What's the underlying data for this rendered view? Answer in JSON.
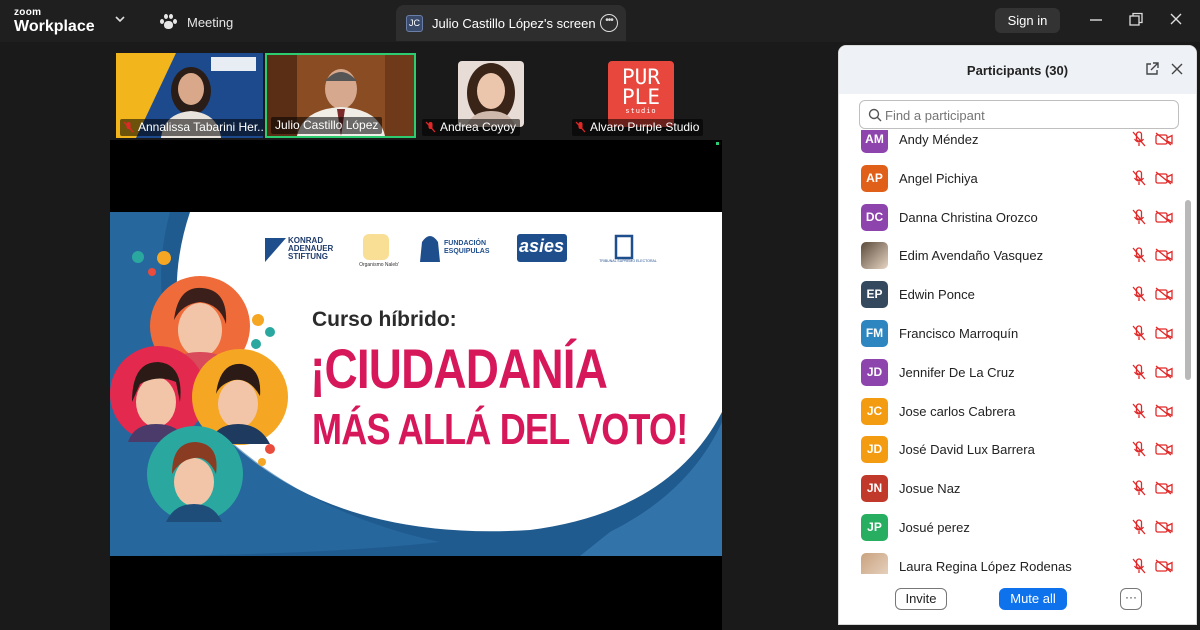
{
  "app": {
    "brand_line1": "zoom",
    "brand_line2": "Workplace"
  },
  "tabs": {
    "meeting": "Meeting",
    "screen_badge": "JC",
    "screen": "Julio Castillo López's screen"
  },
  "header": {
    "sign_in": "Sign in"
  },
  "gallery": [
    {
      "name": "Annalissa Tabarini Her..."
    },
    {
      "name": "Julio Castillo López"
    },
    {
      "name": "Andrea Coyoy"
    },
    {
      "name": "Alvaro Purple Studio"
    }
  ],
  "purple_logo": {
    "l1": "PUR",
    "l2": "PLE",
    "l3": "studio"
  },
  "slide": {
    "org1": "KONRAD",
    "org1b": "ADENAUER",
    "org1c": "STIFTUNG",
    "org2": "Organismo Naleb'",
    "org3": "FUNDACIÓN ESQUIPULAS",
    "org4": "asies",
    "org5": "TRIBUNAL SUPREMO ELECTORAL",
    "subtitle": "Curso híbrido:",
    "title1": "¡CIUDADANÍA",
    "title2": "MÁS ALLÁ DEL VOTO!"
  },
  "participants": {
    "title": "Participants (30)",
    "search_placeholder": "Find a participant",
    "invite": "Invite",
    "mute_all": "Mute all",
    "more": "···",
    "list": [
      {
        "initials": "AM",
        "name": "Andy Méndez",
        "color": "#8e44ad"
      },
      {
        "initials": "AP",
        "name": "Angel Pichiya",
        "color": "#e0601a"
      },
      {
        "initials": "DC",
        "name": "Danna Christina Orozco",
        "color": "#8e44ad"
      },
      {
        "initials": "",
        "name": "Edim Avendaño Vasquez",
        "color": "#5a4a3a"
      },
      {
        "initials": "EP",
        "name": "Edwin Ponce",
        "color": "#34495e"
      },
      {
        "initials": "FM",
        "name": "Francisco Marroquín",
        "color": "#2e86c1"
      },
      {
        "initials": "JD",
        "name": "Jennifer De La Cruz",
        "color": "#8e44ad"
      },
      {
        "initials": "JC",
        "name": "Jose carlos Cabrera",
        "color": "#f39c12"
      },
      {
        "initials": "JD",
        "name": "José David Lux Barrera",
        "color": "#f39c12"
      },
      {
        "initials": "JN",
        "name": "Josue Naz",
        "color": "#c0392b"
      },
      {
        "initials": "JP",
        "name": "Josué perez",
        "color": "#27ae60"
      },
      {
        "initials": "",
        "name": "Laura Regina López Rodenas",
        "color": "#c9a27e"
      }
    ]
  }
}
